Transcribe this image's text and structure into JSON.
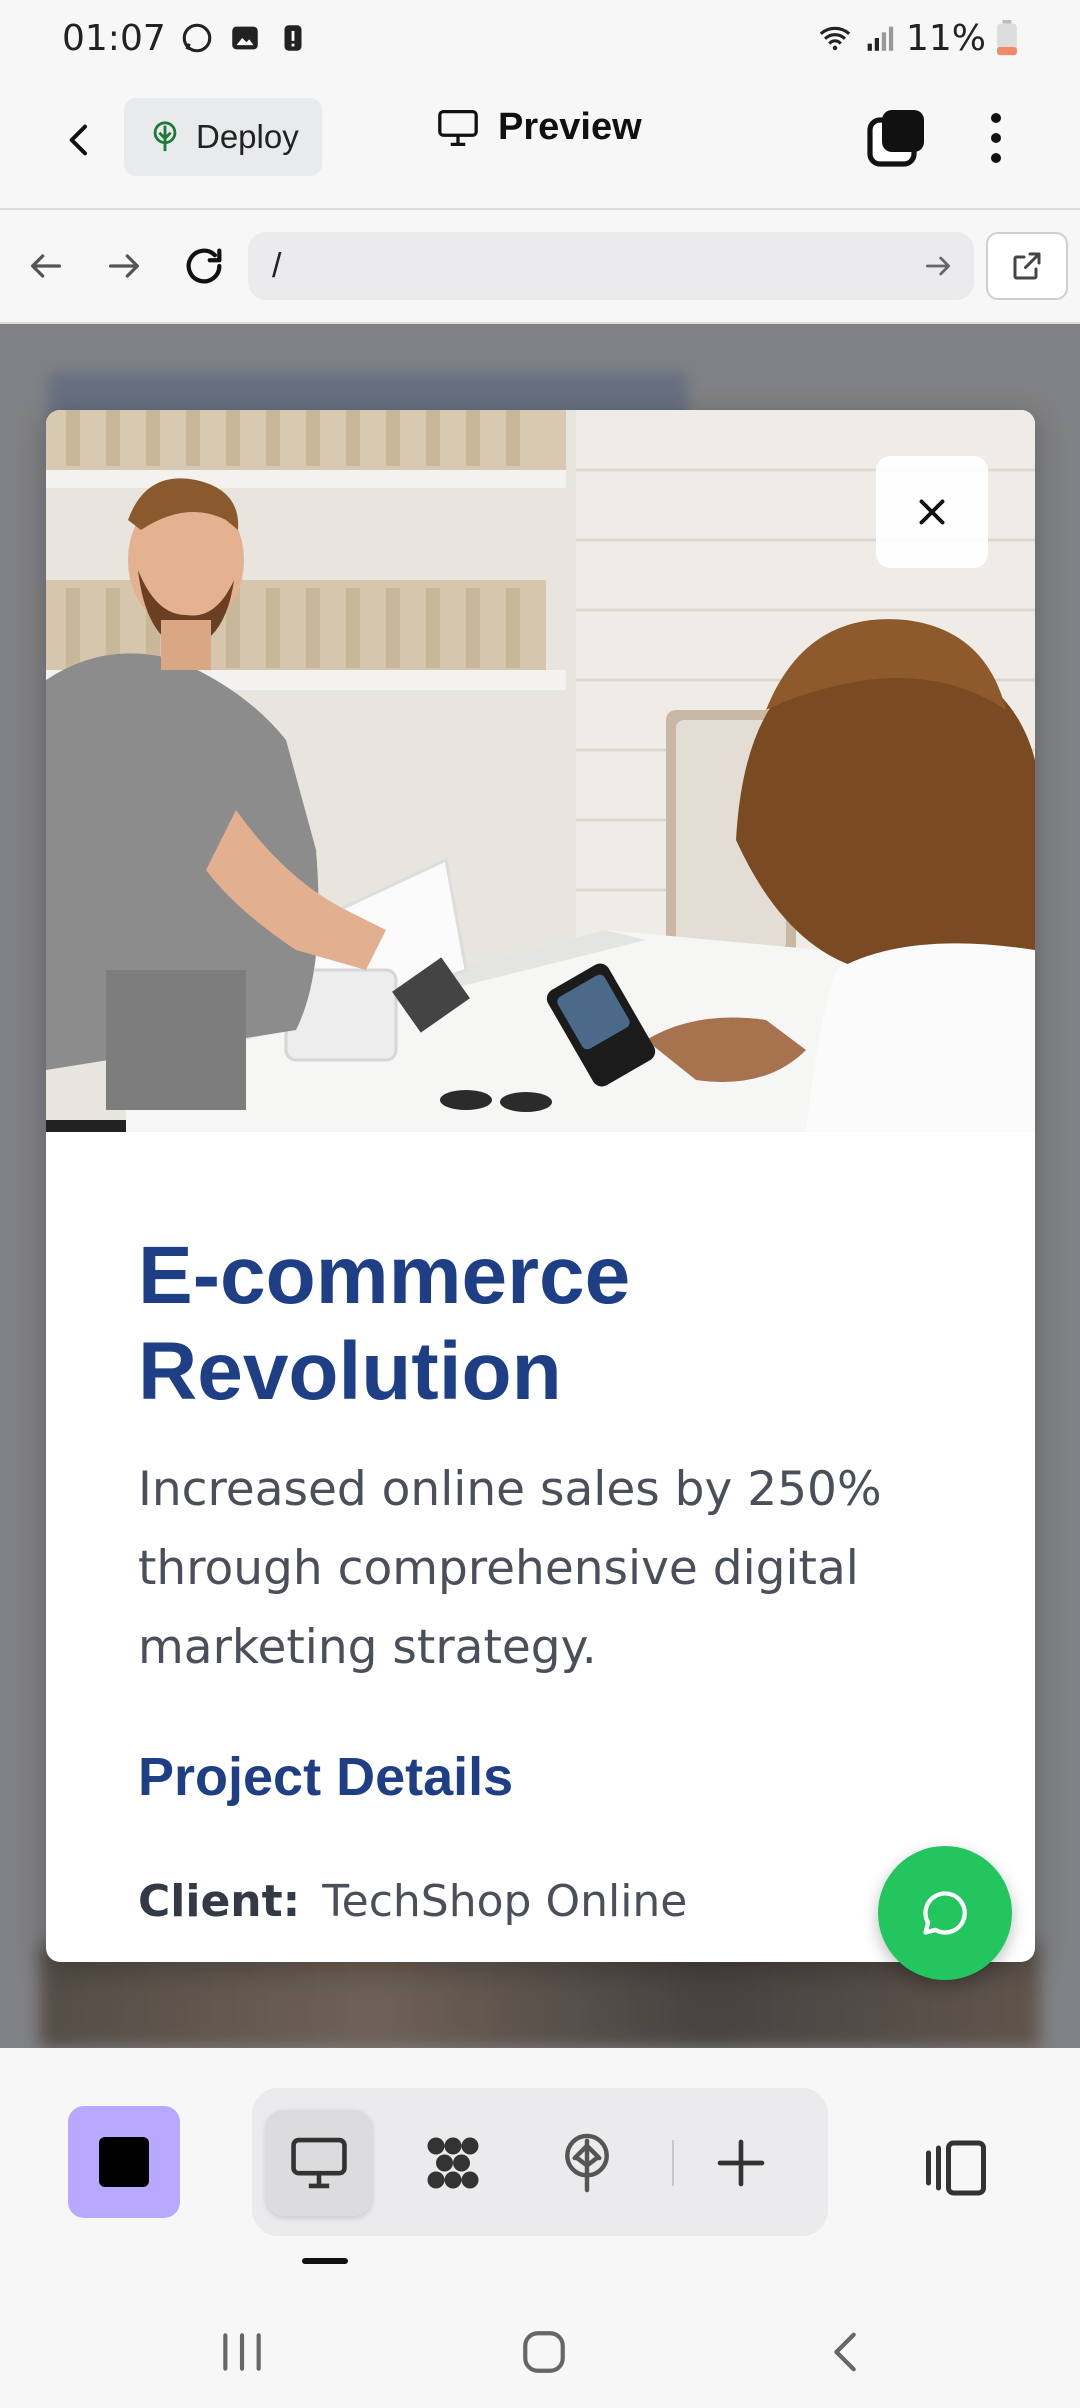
{
  "status_bar": {
    "time": "01:07",
    "battery": "11%"
  },
  "header": {
    "deploy_label": "Deploy",
    "preview_label": "Preview"
  },
  "address_bar": {
    "url": "/"
  },
  "modal": {
    "title": "E-commerce Revolution",
    "description": "Increased online sales by 250% through comprehensive digital marketing strategy.",
    "details_heading": "Project Details",
    "client_label": "Client:",
    "client_value": "TechShop Online"
  },
  "colors": {
    "title_blue": "#1e3f86",
    "fab_green": "#22c55e",
    "stop_purple": "#b9a8ff"
  },
  "icons": {
    "status": [
      "whatsapp-icon",
      "gallery-icon",
      "alert-icon",
      "wifi-icon",
      "signal-icon",
      "battery-icon"
    ],
    "toolbar": [
      "desktop-icon",
      "components-icon",
      "deploy-tree-icon",
      "plus-icon",
      "split-view-icon"
    ],
    "system": [
      "recents-icon",
      "home-icon",
      "back-icon"
    ]
  }
}
